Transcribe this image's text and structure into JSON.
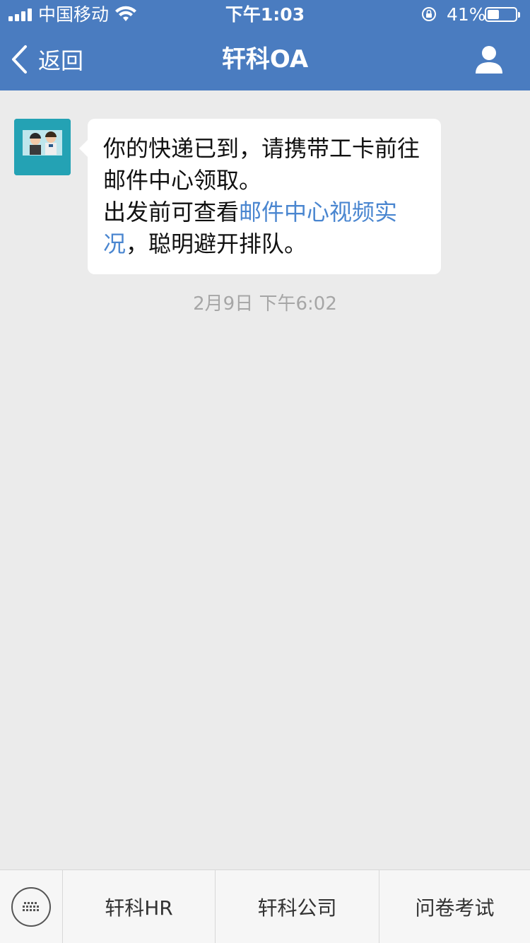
{
  "status_bar": {
    "carrier": "中国移动",
    "time": "下午1:03",
    "battery_percent_label": "41%",
    "battery_level": 0.41
  },
  "nav": {
    "back_label": "返回",
    "title": "轩科OA"
  },
  "message": {
    "line1": "你的快递已到，请携带工卡前往邮件中心领取。",
    "line2_prefix": "出发前可查看",
    "link_text": "邮件中心视频实况",
    "line2_suffix": "，聪明避开排队。",
    "timestamp": "2月9日 下午6:02"
  },
  "bottom_menu": {
    "items": [
      {
        "label": "轩科HR"
      },
      {
        "label": "轩科公司"
      },
      {
        "label": "问卷考试"
      }
    ]
  },
  "colors": {
    "header": "#4a7cc0",
    "background": "#ebebeb",
    "link": "#4a86d0"
  },
  "icons": [
    "signal-icon",
    "wifi-icon",
    "rotation-lock-icon",
    "battery-icon",
    "back-chevron-icon",
    "profile-icon",
    "keyboard-icon"
  ]
}
